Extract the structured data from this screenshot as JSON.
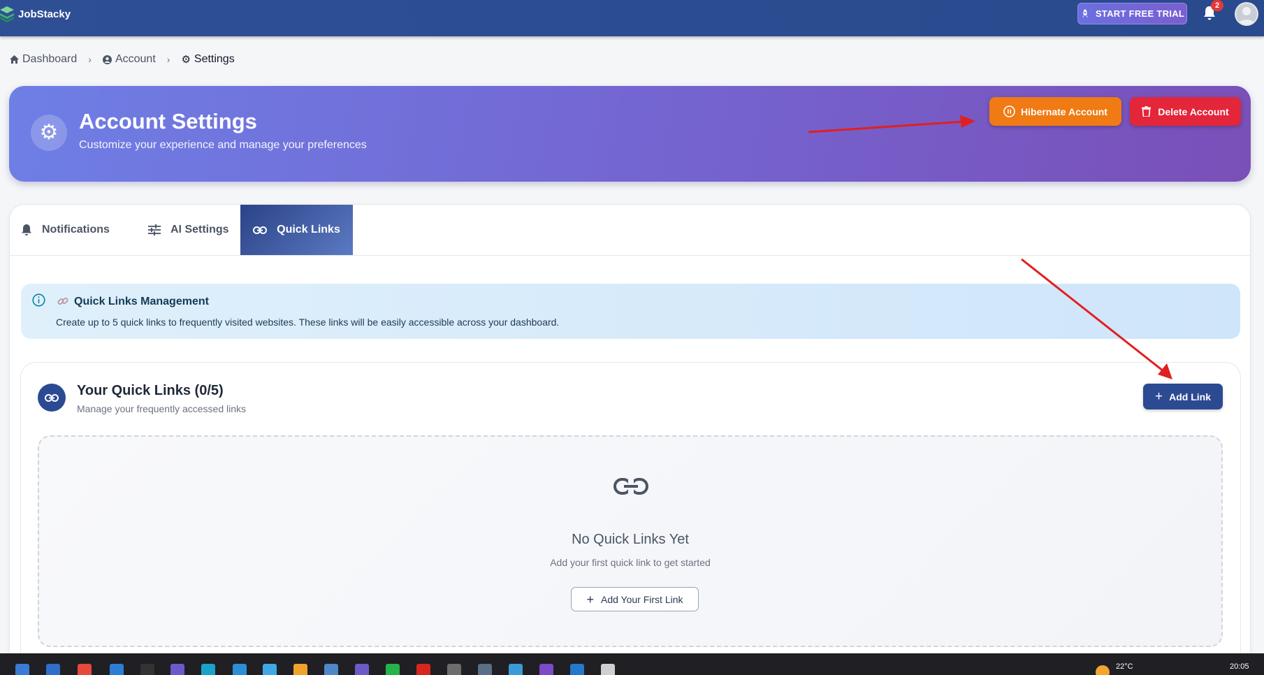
{
  "topbar": {
    "brand": "JobStacky",
    "trial_label": "START FREE TRIAL",
    "notification_count": "2"
  },
  "breadcrumb": {
    "items": [
      "Dashboard",
      "Account",
      "Settings"
    ]
  },
  "header": {
    "title": "Account Settings",
    "subtitle": "Customize your experience and manage your preferences",
    "hibernate_label": "Hibernate Account",
    "delete_label": "Delete Account"
  },
  "tabs": [
    {
      "label": "Notifications",
      "active": false
    },
    {
      "label": "AI Settings",
      "active": false
    },
    {
      "label": "Quick Links",
      "active": true
    }
  ],
  "info": {
    "title": "Quick Links Management",
    "text": "Create up to 5 quick links to frequently visited websites. These links will be easily accessible across your dashboard."
  },
  "quick_links": {
    "title": "Your Quick Links (0/5)",
    "subtitle": "Manage your frequently accessed links",
    "add_label": "Add Link",
    "empty_title": "No Quick Links Yet",
    "empty_subtitle": "Add your first quick link to get started",
    "add_first_label": "Add Your First Link"
  },
  "taskbar": {
    "weather": "22°C",
    "clock": "20:05"
  },
  "colors": {
    "primary": "#2c4a92",
    "hibernate": "#f07a14",
    "delete": "#e3263a",
    "annotation_arrow": "#e02020"
  }
}
